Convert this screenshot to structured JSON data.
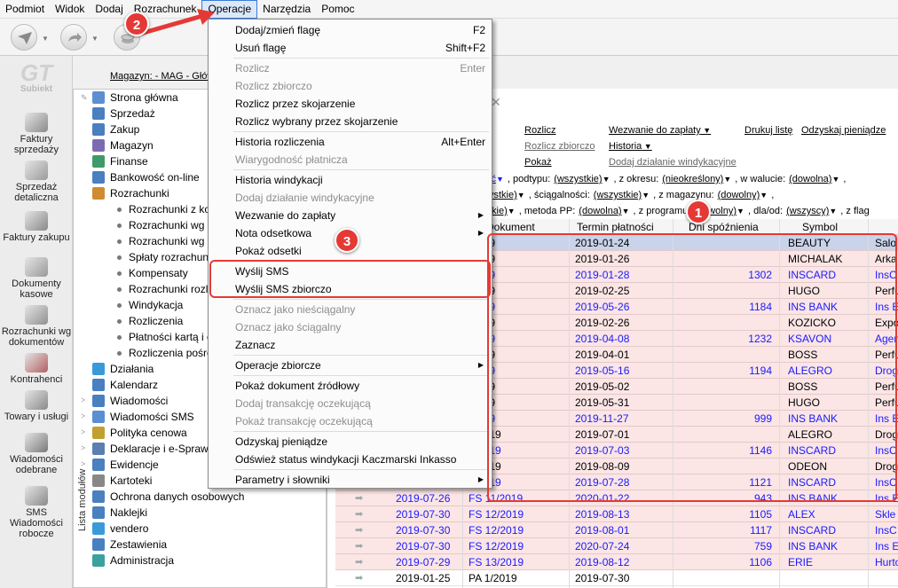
{
  "menubar": [
    "Podmiot",
    "Widok",
    "Dodaj",
    "Rozrachunek",
    "Operacje",
    "Narzędzia",
    "Pomoc"
  ],
  "magazyn": "Magazyn: - MAG - Głów",
  "logo": "Subiekt",
  "leftbar": [
    {
      "label": "Faktury sprzedaży",
      "icon": "invoice-sales-icon"
    },
    {
      "label": "Sprzedaż detaliczna",
      "icon": "retail-icon"
    },
    {
      "label": "Faktury zakupu",
      "icon": "invoice-purchase-icon"
    },
    {
      "label": "Dokumenty kasowe",
      "icon": "cash-documents-icon"
    },
    {
      "label": "Rozrachunki wg dokumentów",
      "icon": "settlements-icon"
    },
    {
      "label": "Kontrahenci",
      "icon": "contractors-icon"
    },
    {
      "label": "Towary i usługi",
      "icon": "goods-icon"
    },
    {
      "label": "Wiadomości odebrane",
      "icon": "messages-received-icon"
    },
    {
      "label": "SMS Wiadomości robocze",
      "icon": "sms-draft-icon"
    }
  ],
  "tree_label": "Lista modułów",
  "tree": [
    {
      "label": "Strona główna",
      "sub": false
    },
    {
      "label": "Sprzedaż",
      "sub": false
    },
    {
      "label": "Zakup",
      "sub": false
    },
    {
      "label": "Magazyn",
      "sub": false
    },
    {
      "label": "Finanse",
      "sub": false
    },
    {
      "label": "Bankowość on-line",
      "sub": false
    },
    {
      "label": "Rozrachunki",
      "sub": false
    },
    {
      "label": "Rozrachunki z ko",
      "sub": true
    },
    {
      "label": "Rozrachunki wg d",
      "sub": true
    },
    {
      "label": "Rozrachunki wg k",
      "sub": true
    },
    {
      "label": "Spłaty rozrachun",
      "sub": true
    },
    {
      "label": "Kompensaty",
      "sub": true
    },
    {
      "label": "Rozrachunki rozli",
      "sub": true
    },
    {
      "label": "Windykacja",
      "sub": true
    },
    {
      "label": "Rozliczenia",
      "sub": true
    },
    {
      "label": "Płatności kartą i c",
      "sub": true
    },
    {
      "label": "Rozliczenia pośre",
      "sub": true
    },
    {
      "label": "Działania",
      "sub": false
    },
    {
      "label": "Kalendarz",
      "sub": false
    },
    {
      "label": "Wiadomości",
      "sub": false
    },
    {
      "label": "Wiadomości SMS",
      "sub": false
    },
    {
      "label": "Polityka cenowa",
      "sub": false
    },
    {
      "label": "Deklaracje i e-Sprawo",
      "sub": false
    },
    {
      "label": "Ewidencje",
      "sub": false
    },
    {
      "label": "Kartoteki",
      "sub": false
    },
    {
      "label": "Ochrona danych osobowych",
      "sub": false
    },
    {
      "label": "Naklejki",
      "sub": false
    },
    {
      "label": "vendero",
      "sub": false
    },
    {
      "label": "Zestawienia",
      "sub": false
    },
    {
      "label": "Administracja",
      "sub": false
    }
  ],
  "actions": {
    "rozlicz": "Rozlicz",
    "rozlicz_zbiorczo": "Rozlicz zbiorczo",
    "pokaz": "Pokaż",
    "wezwanie": "Wezwanie do zapłaty",
    "historia": "Historia",
    "dodaj_dzialanie": "Dodaj działanie windykacyjne",
    "drukuj": "Drukuj listę",
    "odzyskaj": "Odzyskaj pieniądze"
  },
  "filters": {
    "r1": [
      ", podtypu:",
      "(wszystkie)",
      ", z okresu:",
      "(nieokreślony)",
      ", w walucie:",
      "(dowolna)",
      ","
    ],
    "r1_lead": "ić",
    "r2_lead": "ystkie)",
    "r2": [
      ", ściągalności:",
      "(wszystkie)",
      ", z magazynu:",
      "(dowolny)",
      ","
    ],
    "r3_lead": "tkie)",
    "r3": [
      ", metoda PP:",
      "(dowolna)",
      ", z programu:",
      "(dowolny)",
      ", dla/od:",
      "(wszyscy)",
      ", z flag"
    ]
  },
  "grid": {
    "headers": [
      "Dokument",
      "Termin płatności",
      "Dni spóźnienia",
      "Symbol"
    ],
    "rows": [
      {
        "date": "",
        "doc": "/2019",
        "term": "2019-01-24",
        "days": "",
        "sym": "BEAUTY",
        "name": "Salo",
        "style": "sel",
        "blue": false
      },
      {
        "date": "",
        "doc": "/2019",
        "term": "2019-01-26",
        "days": "",
        "sym": "MICHALAK",
        "name": "Arka",
        "style": "pink",
        "blue": false
      },
      {
        "date": "",
        "doc": "/2019",
        "term": "2019-01-28",
        "days": "1302",
        "sym": "INSCARD",
        "name": "InsC",
        "style": "pink",
        "blue": true
      },
      {
        "date": "",
        "doc": "/2019",
        "term": "2019-02-25",
        "days": "",
        "sym": "HUGO",
        "name": "Perfu",
        "style": "pink",
        "blue": false
      },
      {
        "date": "",
        "doc": "/2019",
        "term": "2019-05-26",
        "days": "1184",
        "sym": "INS BANK",
        "name": "Ins E",
        "style": "pink",
        "blue": true
      },
      {
        "date": "",
        "doc": "/2019",
        "term": "2019-02-26",
        "days": "",
        "sym": "KOZICKO",
        "name": "Expo",
        "style": "pink",
        "blue": false
      },
      {
        "date": "",
        "doc": "/2019",
        "term": "2019-04-08",
        "days": "1232",
        "sym": "KSAVON",
        "name": "Agen",
        "style": "pink",
        "blue": true
      },
      {
        "date": "",
        "doc": "/2019",
        "term": "2019-04-01",
        "days": "",
        "sym": "BOSS",
        "name": "Perfu",
        "style": "pink",
        "blue": false
      },
      {
        "date": "",
        "doc": "/2019",
        "term": "2019-05-16",
        "days": "1194",
        "sym": "ALEGRO",
        "name": "Drog",
        "style": "pink",
        "blue": true
      },
      {
        "date": "",
        "doc": "/2019",
        "term": "2019-05-02",
        "days": "",
        "sym": "BOSS",
        "name": "Perfu",
        "style": "pink",
        "blue": false
      },
      {
        "date": "",
        "doc": "/2019",
        "term": "2019-05-31",
        "days": "",
        "sym": "HUGO",
        "name": "Perfu",
        "style": "pink",
        "blue": false
      },
      {
        "date": "",
        "doc": "/2019",
        "term": "2019-11-27",
        "days": "999",
        "sym": "INS BANK",
        "name": "Ins E",
        "style": "pink",
        "blue": true
      },
      {
        "date": "",
        "doc": "0/2019",
        "term": "2019-07-01",
        "days": "",
        "sym": "ALEGRO",
        "name": "Drog",
        "style": "pink",
        "blue": false
      },
      {
        "date": "",
        "doc": "0/2019",
        "term": "2019-07-03",
        "days": "1146",
        "sym": "INSCARD",
        "name": "InsC",
        "style": "pink",
        "blue": true
      },
      {
        "date": "",
        "doc": "1/2019",
        "term": "2019-08-09",
        "days": "",
        "sym": "ODEON",
        "name": "Drog",
        "style": "pink",
        "blue": false
      },
      {
        "date": "",
        "doc": "1/2019",
        "term": "2019-07-28",
        "days": "1121",
        "sym": "INSCARD",
        "name": "InsC",
        "style": "pink",
        "blue": true
      },
      {
        "date": "2019-07-26",
        "doc": "FS 11/2019",
        "term": "2020-01-22",
        "days": "943",
        "sym": "INS BANK",
        "name": "Ins E",
        "style": "pink",
        "blue": true
      },
      {
        "date": "2019-07-30",
        "doc": "FS 12/2019",
        "term": "2019-08-13",
        "days": "1105",
        "sym": "ALEX",
        "name": "Skle",
        "style": "pink",
        "blue": true
      },
      {
        "date": "2019-07-30",
        "doc": "FS 12/2019",
        "term": "2019-08-01",
        "days": "1117",
        "sym": "INSCARD",
        "name": "InsC",
        "style": "pink",
        "blue": true
      },
      {
        "date": "2019-07-30",
        "doc": "FS 12/2019",
        "term": "2020-07-24",
        "days": "759",
        "sym": "INS BANK",
        "name": "Ins E",
        "style": "pink",
        "blue": true
      },
      {
        "date": "2019-07-29",
        "doc": "FS 13/2019",
        "term": "2019-08-12",
        "days": "1106",
        "sym": "ERIE",
        "name": "Hurto",
        "style": "pink",
        "blue": true
      },
      {
        "date": "2019-01-25",
        "doc": "PA 1/2019",
        "term": "2019-07-30",
        "days": "",
        "sym": "",
        "name": "",
        "style": "white",
        "blue": false
      }
    ]
  },
  "dropdown": [
    {
      "label": "Dodaj/zmień flagę",
      "sc": "F2",
      "dis": false
    },
    {
      "label": "Usuń flagę",
      "sc": "Shift+F2",
      "dis": false
    },
    {
      "sep": true
    },
    {
      "label": "Rozlicz",
      "sc": "Enter",
      "dis": true
    },
    {
      "label": "Rozlicz zbiorczo",
      "sc": "",
      "dis": true
    },
    {
      "label": "Rozlicz przez skojarzenie",
      "sc": "",
      "dis": false
    },
    {
      "label": "Rozlicz wybrany przez skojarzenie",
      "sc": "",
      "dis": false
    },
    {
      "sep": true
    },
    {
      "label": "Historia rozliczenia",
      "sc": "Alt+Enter",
      "dis": false
    },
    {
      "label": "Wiarygodność płatnicza",
      "sc": "",
      "dis": true
    },
    {
      "sep": true
    },
    {
      "label": "Historia windykacji",
      "sc": "",
      "dis": false
    },
    {
      "label": "Dodaj działanie windykacyjne",
      "sc": "",
      "dis": true
    },
    {
      "label": "Wezwanie do zapłaty",
      "sc": "",
      "dis": false,
      "sub": true
    },
    {
      "label": "Nota odsetkowa",
      "sc": "",
      "dis": false,
      "sub": true
    },
    {
      "label": "Pokaż odsetki",
      "sc": "",
      "dis": false
    },
    {
      "sep": true
    },
    {
      "label": "Wyślij SMS",
      "sc": "",
      "dis": false
    },
    {
      "label": "Wyślij SMS zbiorczo",
      "sc": "",
      "dis": false
    },
    {
      "sep": true
    },
    {
      "label": "Oznacz jako nieściągalny",
      "sc": "",
      "dis": true
    },
    {
      "label": "Oznacz jako ściągalny",
      "sc": "",
      "dis": true
    },
    {
      "label": "Zaznacz",
      "sc": "",
      "dis": false
    },
    {
      "sep": true
    },
    {
      "label": "Operacje zbiorcze",
      "sc": "",
      "dis": false,
      "sub": true
    },
    {
      "sep": true
    },
    {
      "label": "Pokaż dokument źródłowy",
      "sc": "",
      "dis": false
    },
    {
      "label": "Dodaj transakcję oczekującą",
      "sc": "",
      "dis": true
    },
    {
      "label": "Pokaż transakcję oczekującą",
      "sc": "",
      "dis": true
    },
    {
      "sep": true
    },
    {
      "label": "Odzyskaj pieniądze",
      "sc": "",
      "dis": false
    },
    {
      "label": "Odśwież status windykacji Kaczmarski Inkasso",
      "sc": "",
      "dis": false
    },
    {
      "sep": true
    },
    {
      "label": "Parametry i słowniki",
      "sc": "",
      "dis": false,
      "sub": true
    }
  ],
  "badges": [
    "1",
    "2",
    "3"
  ],
  "colors": {
    "accent": "#e53935",
    "selection": "#c9d3ea",
    "overdue": "#fbe5e5",
    "link": "#1a1aff"
  }
}
